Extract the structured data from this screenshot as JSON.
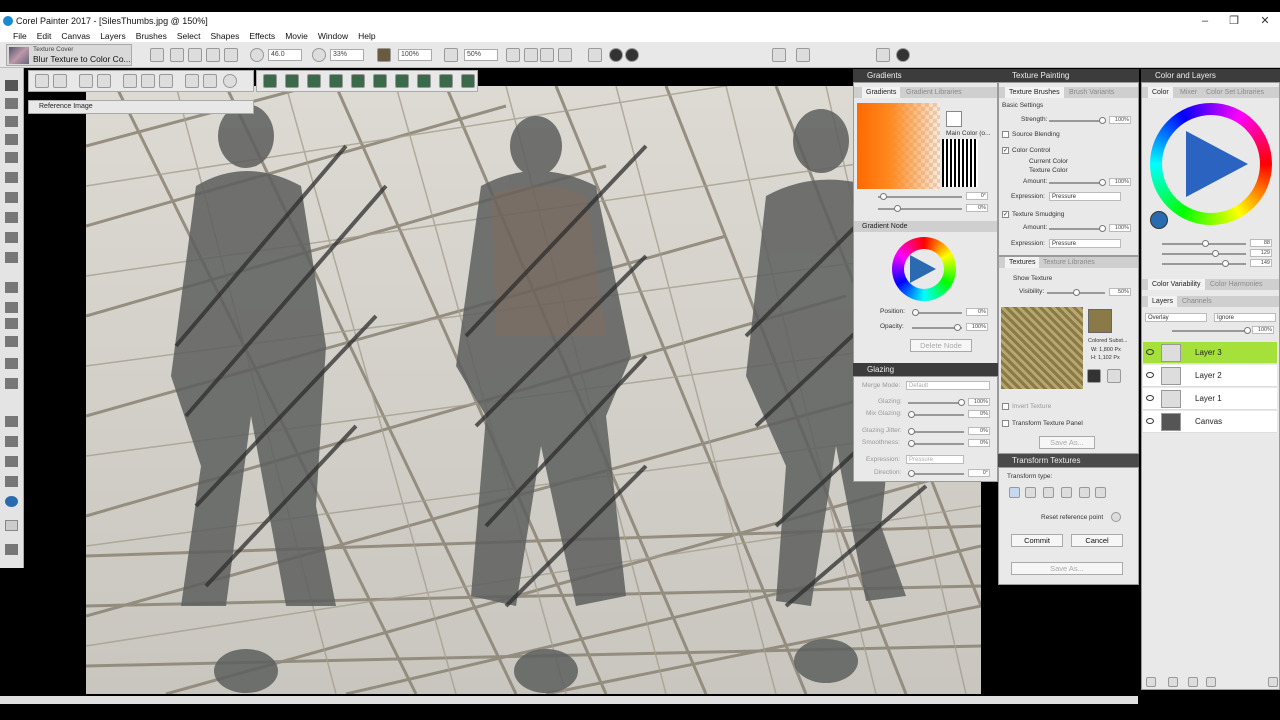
{
  "window": {
    "title": "Corel Painter 2017 - [SilesThumbs.jpg @ 150%]",
    "controls": [
      "–",
      "❐",
      "✕"
    ]
  },
  "menu": [
    "File",
    "Edit",
    "Canvas",
    "Select",
    "Shapes",
    "Effects",
    "Movie",
    "Window",
    "Help"
  ],
  "menu_actual": [
    "File",
    "Edit",
    "Canvas",
    "Layers",
    "Brushes",
    "Select",
    "Shapes",
    "Effects",
    "Movie",
    "Window",
    "Help"
  ],
  "brush_selector": {
    "category": "Texture Cover",
    "variant": "Blur Texture to Color Co..."
  },
  "property_bar": {
    "size": "46.0",
    "opacity": "33%",
    "grain": "100%",
    "bleed": "50%"
  },
  "reference_image": {
    "label": "Reference Image"
  },
  "gradients_panel": {
    "title": "Gradients",
    "tabs": [
      "Gradients",
      "Gradient Libraries"
    ],
    "main_color_label": "Main Color (o...",
    "node_section": "Gradient Node",
    "position_label": "Position:",
    "position_value": "0%",
    "opacity_label": "Opacity:",
    "opacity_value": "100%",
    "delete_node": "Delete Node",
    "angle_value": "0°",
    "repeat_value": "0%"
  },
  "glazing_panel": {
    "title": "Glazing",
    "merge_mode_label": "Merge Mode:",
    "merge_mode_value": "Default",
    "glazing_label": "Glazing:",
    "glazing_value": "100%",
    "mix_glazing_label": "Mix Glazing:",
    "mix_glazing_value": "0%",
    "glazing_jitter_label": "Glazing Jitter:",
    "glazing_jitter_value": "0%",
    "smoothness_label": "Smoothness:",
    "smoothness_value": "0%",
    "expression_label": "Expression:",
    "expression_value": "Pressure",
    "direction_label": "Direction:",
    "direction_value": "0°"
  },
  "texture_painting_panel": {
    "title": "Texture Painting",
    "tabs": [
      "Texture Brushes",
      "Brush Variants"
    ],
    "basic_settings": "Basic Settings",
    "strength_label": "Strength:",
    "strength_value": "100%",
    "source_blending": "Source Blending",
    "color_control": "Color Control",
    "current_color": "Current Color",
    "texture_color": "Texture Color",
    "amount_label": "Amount:",
    "amount_value": "100%",
    "expression_label": "Expression:",
    "expression_value": "Pressure",
    "texture_smudging": "Texture Smudging",
    "amount2_value": "100%",
    "expression2_value": "Pressure"
  },
  "textures_panel": {
    "title": "Textures",
    "tabs": [
      "Textures",
      "Texture Libraries"
    ],
    "show_texture": "Show Texture",
    "visibility_label": "Visibility:",
    "visibility_value": "50%",
    "texture_name": "Colored Subst...",
    "w_label": "W: 1,800 Px",
    "h_label": "H: 1,102 Px",
    "invert_texture": "Invert Texture",
    "transform_panel_label": "Transform Texture Panel",
    "save_as": "Save As..."
  },
  "transform_textures_panel": {
    "title": "Transform Textures",
    "transform_type": "Transform type:",
    "reset_label": "Reset reference point",
    "commit": "Commit",
    "cancel": "Cancel",
    "save_as": "Save As..."
  },
  "color_layers_panel": {
    "title": "Color and Layers",
    "color_tabs": [
      "Color",
      "Mixer",
      "Color Set Libraries"
    ],
    "rgb": [
      "88",
      "129",
      "149"
    ],
    "color_variability": "Color Variability",
    "color_harmonies": "Color Harmonies",
    "layer_tabs": [
      "Layers",
      "Channels"
    ],
    "composite_method": "Overlay",
    "composite_depth": "Ignore",
    "layer_opacity": "100%",
    "layers": [
      "Layer 3",
      "Layer 2",
      "Layer 1",
      "Canvas"
    ],
    "selected_layer": "Layer 3"
  },
  "colors": {
    "layer_selected": "#a6e03b",
    "panel_header": "#3c3c3c",
    "gradient_orange": "#ff7a10",
    "canvas_bg": "#cfcdc6"
  }
}
